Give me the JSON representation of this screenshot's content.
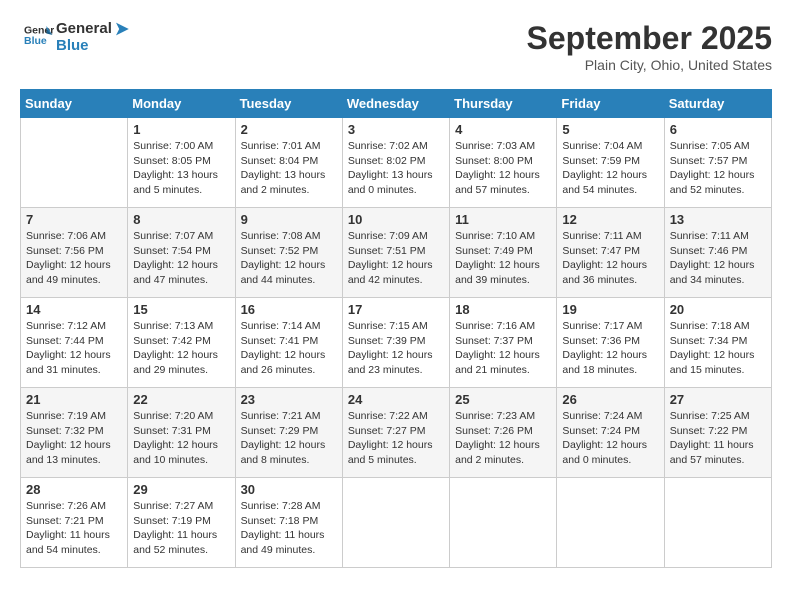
{
  "header": {
    "logo_line1": "General",
    "logo_line2": "Blue",
    "month": "September 2025",
    "location": "Plain City, Ohio, United States"
  },
  "days_of_week": [
    "Sunday",
    "Monday",
    "Tuesday",
    "Wednesday",
    "Thursday",
    "Friday",
    "Saturday"
  ],
  "weeks": [
    [
      {
        "day": "",
        "sunrise": "",
        "sunset": "",
        "daylight": ""
      },
      {
        "day": "1",
        "sunrise": "Sunrise: 7:00 AM",
        "sunset": "Sunset: 8:05 PM",
        "daylight": "Daylight: 13 hours and 5 minutes."
      },
      {
        "day": "2",
        "sunrise": "Sunrise: 7:01 AM",
        "sunset": "Sunset: 8:04 PM",
        "daylight": "Daylight: 13 hours and 2 minutes."
      },
      {
        "day": "3",
        "sunrise": "Sunrise: 7:02 AM",
        "sunset": "Sunset: 8:02 PM",
        "daylight": "Daylight: 13 hours and 0 minutes."
      },
      {
        "day": "4",
        "sunrise": "Sunrise: 7:03 AM",
        "sunset": "Sunset: 8:00 PM",
        "daylight": "Daylight: 12 hours and 57 minutes."
      },
      {
        "day": "5",
        "sunrise": "Sunrise: 7:04 AM",
        "sunset": "Sunset: 7:59 PM",
        "daylight": "Daylight: 12 hours and 54 minutes."
      },
      {
        "day": "6",
        "sunrise": "Sunrise: 7:05 AM",
        "sunset": "Sunset: 7:57 PM",
        "daylight": "Daylight: 12 hours and 52 minutes."
      }
    ],
    [
      {
        "day": "7",
        "sunrise": "Sunrise: 7:06 AM",
        "sunset": "Sunset: 7:56 PM",
        "daylight": "Daylight: 12 hours and 49 minutes."
      },
      {
        "day": "8",
        "sunrise": "Sunrise: 7:07 AM",
        "sunset": "Sunset: 7:54 PM",
        "daylight": "Daylight: 12 hours and 47 minutes."
      },
      {
        "day": "9",
        "sunrise": "Sunrise: 7:08 AM",
        "sunset": "Sunset: 7:52 PM",
        "daylight": "Daylight: 12 hours and 44 minutes."
      },
      {
        "day": "10",
        "sunrise": "Sunrise: 7:09 AM",
        "sunset": "Sunset: 7:51 PM",
        "daylight": "Daylight: 12 hours and 42 minutes."
      },
      {
        "day": "11",
        "sunrise": "Sunrise: 7:10 AM",
        "sunset": "Sunset: 7:49 PM",
        "daylight": "Daylight: 12 hours and 39 minutes."
      },
      {
        "day": "12",
        "sunrise": "Sunrise: 7:11 AM",
        "sunset": "Sunset: 7:47 PM",
        "daylight": "Daylight: 12 hours and 36 minutes."
      },
      {
        "day": "13",
        "sunrise": "Sunrise: 7:11 AM",
        "sunset": "Sunset: 7:46 PM",
        "daylight": "Daylight: 12 hours and 34 minutes."
      }
    ],
    [
      {
        "day": "14",
        "sunrise": "Sunrise: 7:12 AM",
        "sunset": "Sunset: 7:44 PM",
        "daylight": "Daylight: 12 hours and 31 minutes."
      },
      {
        "day": "15",
        "sunrise": "Sunrise: 7:13 AM",
        "sunset": "Sunset: 7:42 PM",
        "daylight": "Daylight: 12 hours and 29 minutes."
      },
      {
        "day": "16",
        "sunrise": "Sunrise: 7:14 AM",
        "sunset": "Sunset: 7:41 PM",
        "daylight": "Daylight: 12 hours and 26 minutes."
      },
      {
        "day": "17",
        "sunrise": "Sunrise: 7:15 AM",
        "sunset": "Sunset: 7:39 PM",
        "daylight": "Daylight: 12 hours and 23 minutes."
      },
      {
        "day": "18",
        "sunrise": "Sunrise: 7:16 AM",
        "sunset": "Sunset: 7:37 PM",
        "daylight": "Daylight: 12 hours and 21 minutes."
      },
      {
        "day": "19",
        "sunrise": "Sunrise: 7:17 AM",
        "sunset": "Sunset: 7:36 PM",
        "daylight": "Daylight: 12 hours and 18 minutes."
      },
      {
        "day": "20",
        "sunrise": "Sunrise: 7:18 AM",
        "sunset": "Sunset: 7:34 PM",
        "daylight": "Daylight: 12 hours and 15 minutes."
      }
    ],
    [
      {
        "day": "21",
        "sunrise": "Sunrise: 7:19 AM",
        "sunset": "Sunset: 7:32 PM",
        "daylight": "Daylight: 12 hours and 13 minutes."
      },
      {
        "day": "22",
        "sunrise": "Sunrise: 7:20 AM",
        "sunset": "Sunset: 7:31 PM",
        "daylight": "Daylight: 12 hours and 10 minutes."
      },
      {
        "day": "23",
        "sunrise": "Sunrise: 7:21 AM",
        "sunset": "Sunset: 7:29 PM",
        "daylight": "Daylight: 12 hours and 8 minutes."
      },
      {
        "day": "24",
        "sunrise": "Sunrise: 7:22 AM",
        "sunset": "Sunset: 7:27 PM",
        "daylight": "Daylight: 12 hours and 5 minutes."
      },
      {
        "day": "25",
        "sunrise": "Sunrise: 7:23 AM",
        "sunset": "Sunset: 7:26 PM",
        "daylight": "Daylight: 12 hours and 2 minutes."
      },
      {
        "day": "26",
        "sunrise": "Sunrise: 7:24 AM",
        "sunset": "Sunset: 7:24 PM",
        "daylight": "Daylight: 12 hours and 0 minutes."
      },
      {
        "day": "27",
        "sunrise": "Sunrise: 7:25 AM",
        "sunset": "Sunset: 7:22 PM",
        "daylight": "Daylight: 11 hours and 57 minutes."
      }
    ],
    [
      {
        "day": "28",
        "sunrise": "Sunrise: 7:26 AM",
        "sunset": "Sunset: 7:21 PM",
        "daylight": "Daylight: 11 hours and 54 minutes."
      },
      {
        "day": "29",
        "sunrise": "Sunrise: 7:27 AM",
        "sunset": "Sunset: 7:19 PM",
        "daylight": "Daylight: 11 hours and 52 minutes."
      },
      {
        "day": "30",
        "sunrise": "Sunrise: 7:28 AM",
        "sunset": "Sunset: 7:18 PM",
        "daylight": "Daylight: 11 hours and 49 minutes."
      },
      {
        "day": "",
        "sunrise": "",
        "sunset": "",
        "daylight": ""
      },
      {
        "day": "",
        "sunrise": "",
        "sunset": "",
        "daylight": ""
      },
      {
        "day": "",
        "sunrise": "",
        "sunset": "",
        "daylight": ""
      },
      {
        "day": "",
        "sunrise": "",
        "sunset": "",
        "daylight": ""
      }
    ]
  ]
}
